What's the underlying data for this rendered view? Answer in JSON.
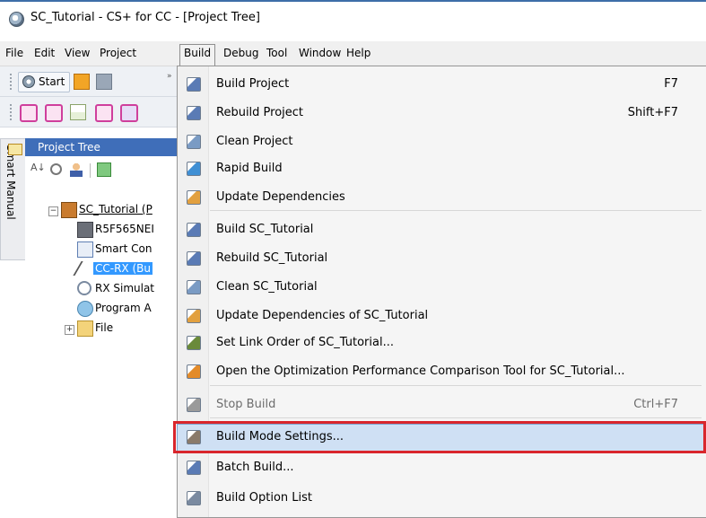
{
  "window": {
    "title": "SC_Tutorial - CS+ for CC - [Project Tree]",
    "icon": "app-logo-icon"
  },
  "menubar": {
    "items": [
      "File",
      "Edit",
      "View",
      "Project",
      "Build",
      "Debug",
      "Tool",
      "Window",
      "Help"
    ],
    "active": "Build"
  },
  "toolbar": {
    "start_label": "Start"
  },
  "side_tab": {
    "label": "Smart Manual"
  },
  "project_panel": {
    "title": "Project Tree",
    "tree": [
      {
        "label": "SC_Tutorial (P",
        "icon": "project-icon"
      },
      {
        "label": "R5F565NEI",
        "icon": "chip-icon"
      },
      {
        "label": "Smart Con",
        "icon": "smart-configurator-icon"
      },
      {
        "label": "CC-RX (Bu",
        "icon": "compiler-icon",
        "selected": true
      },
      {
        "label": "RX Simulat",
        "icon": "simulator-icon"
      },
      {
        "label": "Program A",
        "icon": "program-analyzer-icon"
      },
      {
        "label": "File",
        "icon": "folder-icon"
      }
    ]
  },
  "build_menu": {
    "items": [
      {
        "label": "Build Project",
        "shortcut": "F7",
        "icon": "build-project-icon"
      },
      {
        "label": "Rebuild Project",
        "shortcut": "Shift+F7",
        "icon": "rebuild-project-icon"
      },
      {
        "label": "Clean Project",
        "shortcut": "",
        "icon": "clean-project-icon"
      },
      {
        "label": "Rapid Build",
        "shortcut": "",
        "icon": "rapid-build-icon"
      },
      {
        "label": "Update Dependencies",
        "shortcut": "",
        "icon": "update-dependencies-icon"
      },
      {
        "label": "Build SC_Tutorial",
        "shortcut": "",
        "icon": "build-file-icon"
      },
      {
        "label": "Rebuild SC_Tutorial",
        "shortcut": "",
        "icon": "rebuild-file-icon"
      },
      {
        "label": "Clean SC_Tutorial",
        "shortcut": "",
        "icon": "clean-file-icon"
      },
      {
        "label": "Update Dependencies of SC_Tutorial",
        "shortcut": "",
        "icon": "update-dependencies-icon"
      },
      {
        "label": "Set Link Order of SC_Tutorial...",
        "shortcut": "",
        "icon": "link-order-icon"
      },
      {
        "label": "Open the Optimization Performance Comparison Tool for SC_Tutorial...",
        "shortcut": "",
        "icon": "performance-chart-icon"
      },
      {
        "label": "Stop Build",
        "shortcut": "Ctrl+F7",
        "icon": "stop-build-icon",
        "disabled": true
      },
      {
        "label": "Build Mode Settings...",
        "shortcut": "",
        "icon": "build-mode-icon",
        "highlighted": true
      },
      {
        "label": "Batch Build...",
        "shortcut": "",
        "icon": "batch-build-icon"
      },
      {
        "label": "Build Option List",
        "shortcut": "",
        "icon": "build-option-list-icon"
      }
    ]
  },
  "colors": {
    "highlight_outline": "#d9262c",
    "hover_fill": "#cfe0f4",
    "panel_header": "#3f6eb9",
    "tree_selection": "#3399ff"
  }
}
